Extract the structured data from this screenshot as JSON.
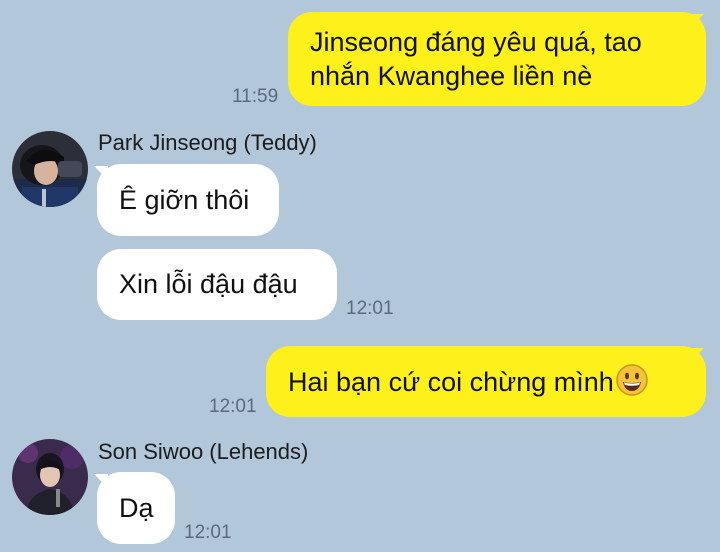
{
  "colors": {
    "background": "#b2c7da",
    "outgoing_bubble": "#fef01b",
    "incoming_bubble": "#ffffff",
    "timestamp": "#5b6b7b"
  },
  "messages": [
    {
      "direction": "outgoing",
      "lines": [
        "Jinseong đáng yêu quá, tao",
        "nhắn Kwanghee liền nè"
      ],
      "time": "11:59"
    },
    {
      "direction": "incoming",
      "sender": "Park Jinseong (Teddy)",
      "avatar_icon": "profile-photo",
      "text": "Ê giỡn thôi"
    },
    {
      "direction": "incoming",
      "text": "Xin lỗi đậu đậu",
      "time": "12:01"
    },
    {
      "direction": "outgoing",
      "text": "Hai bạn cứ coi chừng mình",
      "emoji": "grinning-face-emoji",
      "time": "12:01"
    },
    {
      "direction": "incoming",
      "sender": "Son Siwoo (Lehends)",
      "avatar_icon": "profile-photo",
      "text": "Dạ",
      "time": "12:01"
    }
  ]
}
